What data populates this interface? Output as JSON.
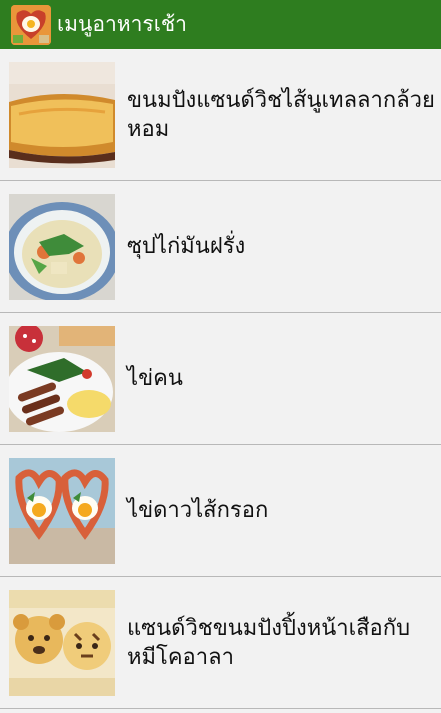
{
  "app": {
    "title": "เมนูอาหารเช้า",
    "header_color": "#2e7d1f",
    "icon": "breakfast-app-icon"
  },
  "menu_items": [
    {
      "title": "ขนมปังแซนด์วิชไส้นูเทลลากล้วยหอม",
      "image": "toast-sandwich-photo"
    },
    {
      "title": "ซุปไก่มันฝรั่ง",
      "image": "chicken-potato-soup-photo"
    },
    {
      "title": "ไข่คน",
      "image": "scrambled-eggs-sausage-photo"
    },
    {
      "title": "ไข่ดาวไส้กรอก",
      "image": "heart-sausage-egg-photo"
    },
    {
      "title": "แซนด์วิชขนมปังปิ้งหน้าเสือกับหมีโคอาลา",
      "image": "tiger-koala-toast-photo"
    }
  ]
}
